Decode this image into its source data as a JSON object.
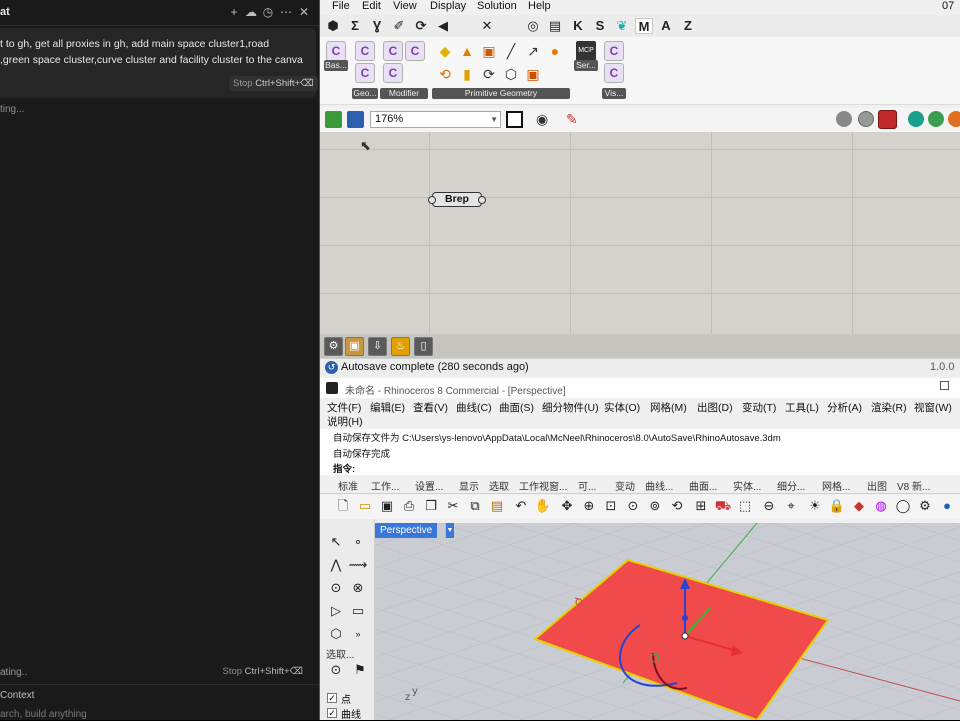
{
  "chat": {
    "title": "at",
    "header_icons": [
      "plus-icon",
      "cloud-icon",
      "history-icon",
      "more-icon",
      "close-icon"
    ],
    "header_glyphs": [
      "+",
      "☁",
      "◷",
      "⋯",
      "✕"
    ],
    "message": "t to gh, get all proxies in gh, add main space cluster1,road\n,green space cluster,curve cluster and facility cluster to the canva",
    "status_top": "ting...",
    "stop_label": "Stop",
    "stop_shortcut": "Ctrl+Shift+⌫",
    "status_bottom": "ating..",
    "stop2_label": "Stop",
    "stop2_shortcut": "Ctrl+Shift+⌫",
    "context_label": "Context",
    "input_placeholder": "arch, build anything"
  },
  "gh": {
    "menu": [
      "File",
      "Edit",
      "View",
      "Display",
      "Solution",
      "Help"
    ],
    "clock": "07",
    "tabs": [
      "⬢",
      "Σ",
      "Ɣ",
      "✐",
      "⟳",
      "◀",
      "✕",
      "◎",
      "▤",
      "K",
      "S",
      "❦",
      "M",
      "A",
      "Z"
    ],
    "active_tab": "M",
    "groups": [
      {
        "label": "Bas...",
        "icons": [
          "C",
          "C"
        ]
      },
      {
        "label": "Geo...",
        "icons": [
          "C",
          "C",
          "C"
        ]
      },
      {
        "label": "Modifier",
        "icons": [
          "C",
          "C",
          "C"
        ]
      },
      {
        "label": "Primitive Geometry",
        "icons": [
          "◆",
          "▲",
          "▣",
          "╱",
          "↗",
          "●",
          "⟲",
          "▮",
          "⟳",
          "⬡",
          "▣"
        ]
      },
      {
        "label": "Ser...",
        "icons": [
          "MCP",
          "C"
        ]
      },
      {
        "label": "Vis...",
        "icons": [
          "C",
          "C"
        ]
      }
    ],
    "zoom": "176%",
    "component": "Brep",
    "status": "Autosave complete (280 seconds ago)",
    "version": "1.0.0"
  },
  "rhino": {
    "title": "未命名 - Rhinoceros 8 Commercial - [Perspective]",
    "menu": [
      "文件(F)",
      "编辑(E)",
      "查看(V)",
      "曲线(C)",
      "曲面(S)",
      "细分物件(U)",
      "实体(O)",
      "网格(M)",
      "出图(D)",
      "变动(T)",
      "工具(L)",
      "分析(A)",
      "渲染(R)",
      "视窗(W)",
      "说明(H)"
    ],
    "cmd_line1": "自动保存文件为 C:\\Users\\ys-lenovo\\AppData\\Local\\McNeel\\Rhinoceros\\8.0\\AutoSave\\RhinoAutosave.3dm",
    "cmd_line2": "自动保存完成",
    "cmd_prompt": "指令:",
    "tabs": [
      "标准",
      "工作...",
      "设置...",
      "显示",
      "选取",
      "工作视窗...",
      "可...",
      "变动",
      "曲线...",
      "曲面...",
      "实体...",
      "细分...",
      "网格...",
      "出图",
      "V8 新..."
    ],
    "viewport": "Perspective",
    "osnap_label": "选取...",
    "osnap_items": [
      "点",
      "曲线"
    ],
    "axis_z": "z",
    "axis_y": "y"
  },
  "colors": {
    "chat_bg": "#1a1a1a",
    "surface": "#f04a4a",
    "edge": "#e6d000",
    "accent": "#3a78d8"
  }
}
